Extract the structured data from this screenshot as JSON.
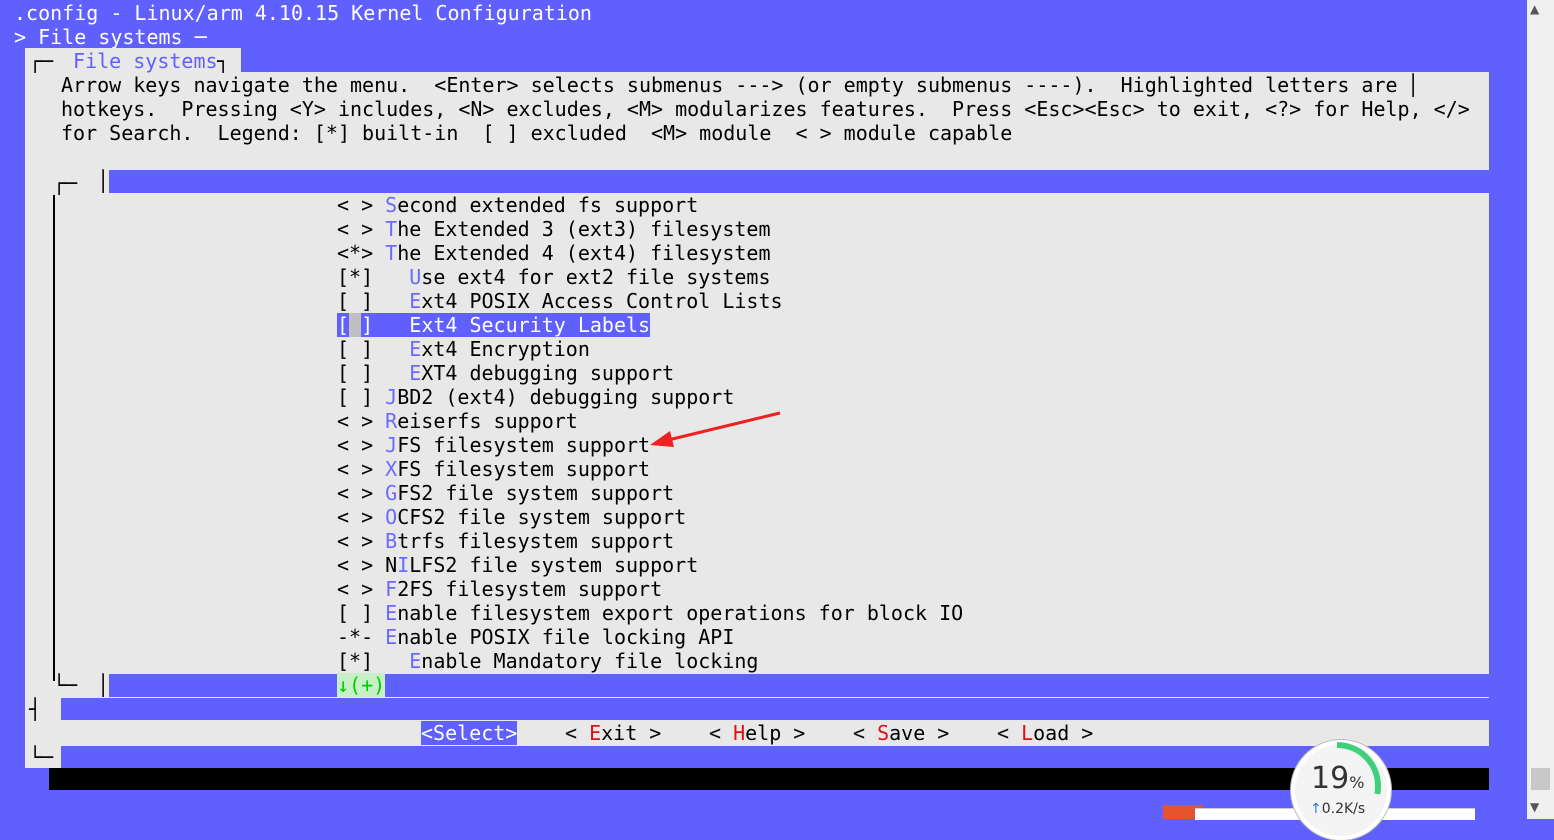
{
  "window": {
    "title_line": ".config - Linux/arm 4.10.15 Kernel Configuration",
    "breadcrumb": "> File systems ─"
  },
  "dialog": {
    "title": " File systems ",
    "help_lines": [
      "Arrow keys navigate the menu.  <Enter> selects submenus ---> (or empty submenus ----).  Highlighted letters are",
      "hotkeys.  Pressing <Y> includes, <N> excludes, <M> modularizes features.  Press <Esc><Esc> to exit, <?> for Help, </>",
      "for Search.  Legend: [*] built-in  [ ] excluded  <M> module  < > module capable"
    ]
  },
  "menu": {
    "items": [
      {
        "prefix": "< > ",
        "hotkey": "S",
        "rest": "econd extended fs support",
        "selected": false
      },
      {
        "prefix": "< > ",
        "hotkey": "T",
        "rest": "he Extended 3 (ext3) filesystem",
        "selected": false
      },
      {
        "prefix": "<*> ",
        "hotkey": "T",
        "rest": "he Extended 4 (ext4) filesystem",
        "selected": false
      },
      {
        "prefix": "[*]   ",
        "hotkey": "U",
        "rest": "se ext4 for ext2 file systems",
        "selected": false
      },
      {
        "prefix": "[ ]   ",
        "hotkey": "E",
        "rest": "xt4 POSIX Access Control Lists",
        "selected": false
      },
      {
        "prefix": "[ ]   ",
        "hotkey": "E",
        "rest": "xt4 Security Labels",
        "selected": true
      },
      {
        "prefix": "[ ]   ",
        "hotkey": "E",
        "rest": "xt4 Encryption",
        "selected": false
      },
      {
        "prefix": "[ ]   ",
        "hotkey": "E",
        "rest": "XT4 debugging support",
        "selected": false
      },
      {
        "prefix": "[ ] ",
        "hotkey": "J",
        "rest": "BD2 (ext4) debugging support",
        "selected": false
      },
      {
        "prefix": "< > ",
        "hotkey": "R",
        "rest": "eiserfs support",
        "selected": false
      },
      {
        "prefix": "< > ",
        "hotkey": "J",
        "rest": "FS filesystem support",
        "selected": false
      },
      {
        "prefix": "< > ",
        "hotkey": "X",
        "rest": "FS filesystem support",
        "selected": false
      },
      {
        "prefix": "< > ",
        "hotkey": "G",
        "rest": "FS2 file system support",
        "selected": false
      },
      {
        "prefix": "< > ",
        "hotkey": "O",
        "rest": "CFS2 file system support",
        "selected": false
      },
      {
        "prefix": "< > ",
        "hotkey": "B",
        "rest": "trfs filesystem support",
        "selected": false
      },
      {
        "prefix": "< > N",
        "hotkey": "I",
        "rest": "LFS2 file system support",
        "selected": false
      },
      {
        "prefix": "< > ",
        "hotkey": "F",
        "rest": "2FS filesystem support",
        "selected": false
      },
      {
        "prefix": "[ ] ",
        "hotkey": "E",
        "rest": "nable filesystem export operations for block IO",
        "selected": false
      },
      {
        "prefix": "-*- ",
        "hotkey": "E",
        "rest": "nable POSIX file locking API",
        "selected": false
      },
      {
        "prefix": "[*]   ",
        "hotkey": "E",
        "rest": "nable Mandatory file locking",
        "selected": false
      }
    ],
    "more_indicator": "↓(+)"
  },
  "buttons": {
    "select": "<Select>",
    "exit": {
      "pre": "< ",
      "hotkey": "E",
      "rest": "xit >"
    },
    "help": {
      "pre": "< ",
      "hotkey": "H",
      "rest": "elp >"
    },
    "save": {
      "pre": "< ",
      "hotkey": "S",
      "rest": "ave >"
    },
    "load": {
      "pre": "< ",
      "hotkey": "L",
      "rest": "oad >"
    }
  },
  "overlay": {
    "percent": "19",
    "percent_sign": "%",
    "speed_arrow": "↑",
    "speed": "0.2K/s"
  },
  "colors": {
    "background": "#6060ff",
    "dialog": "#e8e8e8",
    "hotkey": "#6a6aff",
    "button_hotkey": "#e01010",
    "annotation_arrow": "#ee2020"
  }
}
